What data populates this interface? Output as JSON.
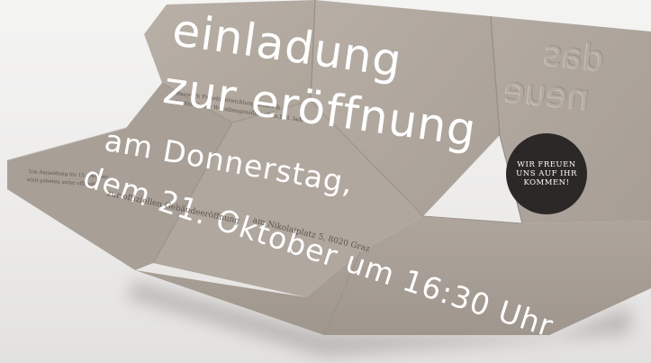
{
  "invitation": {
    "title_line1": "einladung",
    "title_line2": "zur eröffnung",
    "date_line1": "am Donnerstag,",
    "date_line2": "dem 21. Oktober um 16:30 Uhr",
    "subline_left": "zur offiziellen Gebäudeeröffnung",
    "subline_right": "am Nikolaiplatz 5, 8020 Graz",
    "badge_line1": "WIR FREUEN",
    "badge_line2": "UNS AUF IHR",
    "badge_line3": "KOMMEN!",
    "emboss_line1": "das",
    "emboss_line2": "neue",
    "host_line1": "Bauwerk Projektentwicklung GmbH &",
    "host_line2": "die Steirische Wohnbaugesellschaft m.b.H. laden",
    "rsvp_line1": "Um Anmeldung bis 15. Oktober",
    "rsvp_line2": "wird gebeten unter office@"
  },
  "colors": {
    "paper": "#b3aaa1",
    "paper_shadow": "#9c938a",
    "badge": "#2b2827",
    "text": "#ffffff"
  }
}
